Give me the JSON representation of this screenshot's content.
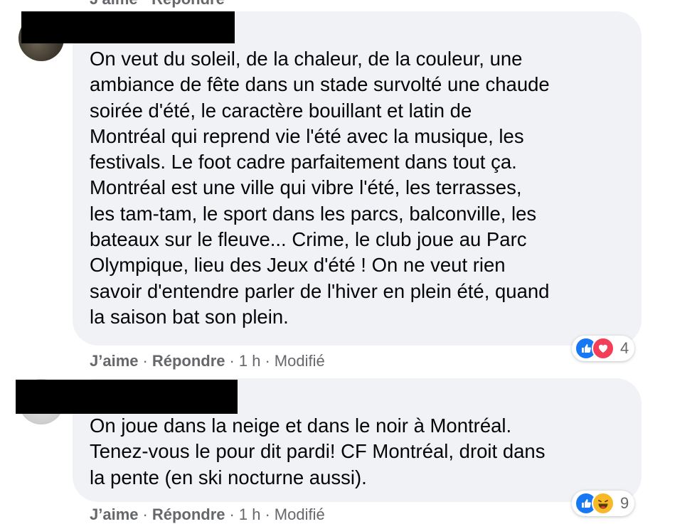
{
  "top_actions": "J'aime · Répondre",
  "comments": [
    {
      "text": "On veut du soleil, de la chaleur, de la couleur, une\nambiance de fête dans un stade survolté une chaude\nsoirée d'été, le caractère bouillant et latin de\nMontréal qui reprend vie l'été avec la musique, les\nfestivals. Le foot cadre parfaitement dans tout ça.\nMontréal est une ville qui vibre l'été, les terrasses,\nles tam-tam, le sport dans les parcs, balconville, les\nbateaux sur le fleuve... Crime, le club joue au Parc\nOlympique, lieu des Jeux d'été ! On ne veut rien\nsavoir d'entendre parler de l'hiver en plein été, quand\nla saison bat son plein.",
      "like_label": "J’aime",
      "reply_label": "Répondre",
      "time": "1 h",
      "edited_label": "Modifié",
      "reactions": [
        "like-icon",
        "love-icon"
      ],
      "reaction_count": "4"
    },
    {
      "text": "On joue dans la neige et dans le noir à Montréal.\nTenez-vous le pour dit pardi! CF Montréal, droit dans\nla pente (en ski nocturne aussi).",
      "like_label": "J’aime",
      "reply_label": "Répondre",
      "time": "1 h",
      "edited_label": "Modifié",
      "reactions": [
        "like-icon",
        "haha-icon"
      ],
      "reaction_count": "9"
    }
  ],
  "colors": {
    "bubble": "#f0f2f5",
    "meta_text": "#65676b",
    "like": "#1877f2",
    "love": "#f33e58",
    "haha": "#f7b928"
  }
}
